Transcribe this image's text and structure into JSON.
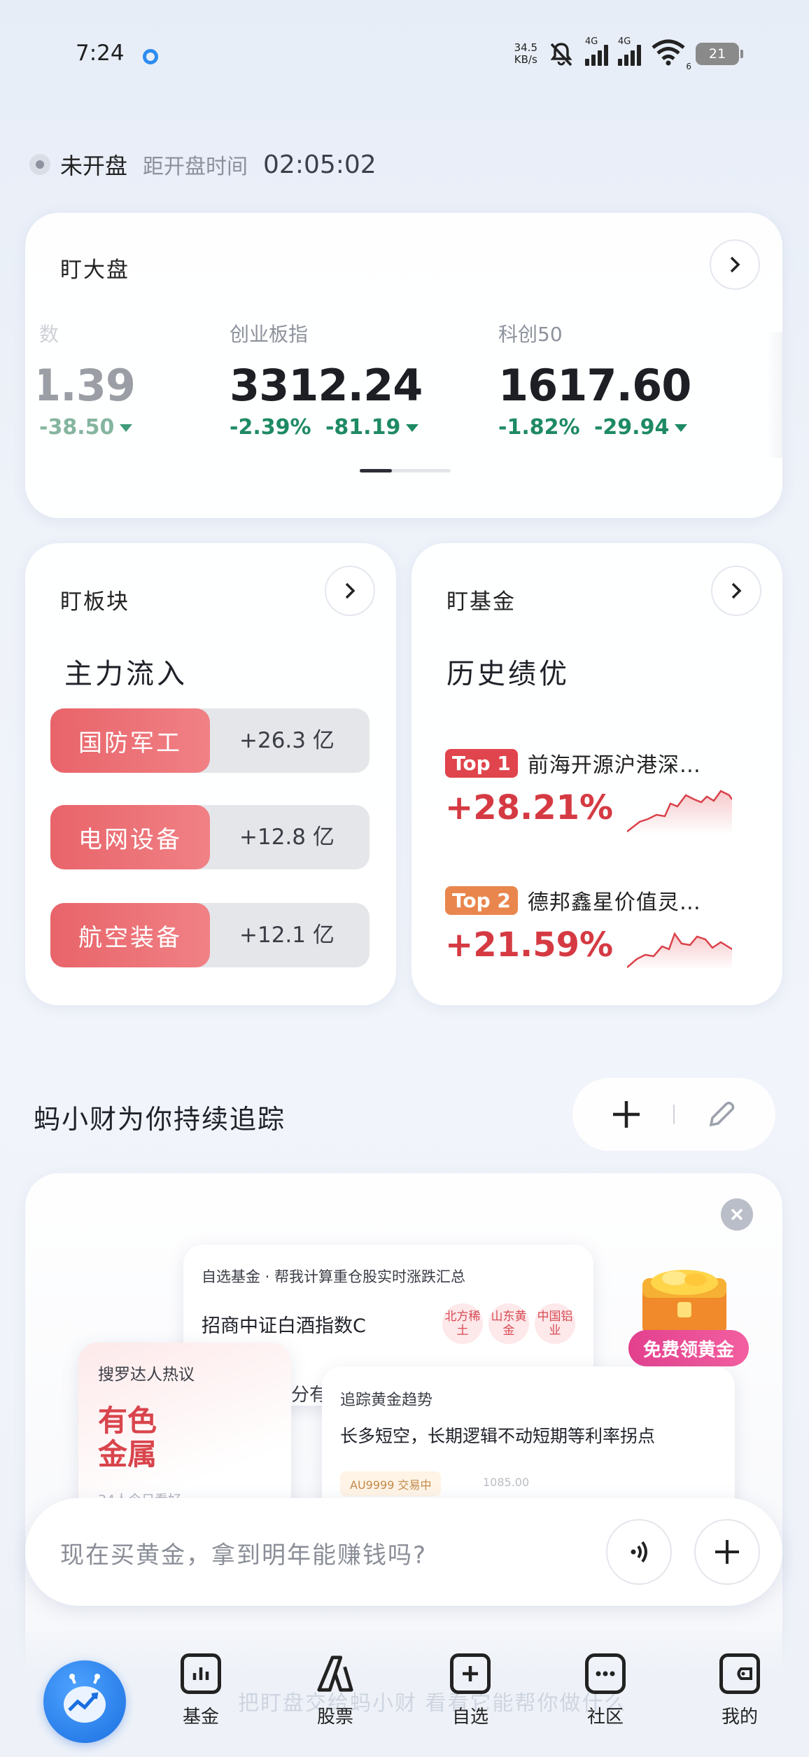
{
  "status_bar": {
    "time": "7:24",
    "net_speed_value": "34.5",
    "net_speed_unit": "KB/s",
    "signal_label_1": "4G",
    "signal_label_2": "4G",
    "wifi_label": "6",
    "battery": "21"
  },
  "market": {
    "status": "未开盘",
    "countdown_label": "距开盘时间",
    "countdown": "02:05:02"
  },
  "watch_market": {
    "title": "盯大盘",
    "indices": [
      {
        "name": "数",
        "value": "1.39",
        "change_pct": "",
        "change": "-38.50"
      },
      {
        "name": "创业板指",
        "value": "3312.24",
        "change_pct": "-2.39%",
        "change": "-81.19"
      },
      {
        "name": "科创50",
        "value": "1617.60",
        "change_pct": "-1.82%",
        "change": "-29.94"
      }
    ]
  },
  "watch_sector": {
    "title": "盯板块",
    "subtitle": "主力流入",
    "items": [
      {
        "name": "国防军工",
        "value": "+26.3 亿"
      },
      {
        "name": "电网设备",
        "value": "+12.8 亿"
      },
      {
        "name": "航空装备",
        "value": "+12.1 亿"
      }
    ]
  },
  "watch_fund": {
    "title": "盯基金",
    "subtitle": "历史绩优",
    "items": [
      {
        "badge": "Top 1",
        "name": "前海开源沪港深…",
        "return": "+28.21%",
        "badge_color": "#e0444c"
      },
      {
        "badge": "Top 2",
        "name": "德邦鑫星价值灵…",
        "return": "+21.59%",
        "badge_color": "#e9864d"
      }
    ]
  },
  "tracking": {
    "title": "蚂小财为你持续追踪",
    "fund_card": {
      "header": "自选基金 · 帮我计算重仓股实时涨跌汇总",
      "fund_name": "招商中证白酒指数C",
      "tags": [
        "北方稀土",
        "山东黄金",
        "中国铝业"
      ]
    },
    "hot_card": {
      "header": "搜罗达人热议",
      "topic_line1": "有色",
      "topic_line2": "金属",
      "people": "34人今日看好"
    },
    "partial_text": "分有",
    "gold_card": {
      "header": "追踪黄金趋势",
      "content": "长多短空，长期逻辑不动短期等利率拐点",
      "tag": "AU9999 交易中",
      "price": "1085.00"
    },
    "promo": "免费领黄金"
  },
  "input": {
    "placeholder": "现在买黄金，拿到明年能赚钱吗?"
  },
  "tabbar": {
    "background_text": "把盯盘交给蚂小财 看看它能帮你做什么",
    "tabs": [
      {
        "label": "基金"
      },
      {
        "label": "股票"
      },
      {
        "label": "自选"
      },
      {
        "label": "社区"
      },
      {
        "label": "我的"
      }
    ]
  },
  "colors": {
    "up_red": "#d53a42",
    "down_green": "#1e8a63",
    "accent_blue": "#2d8cf0"
  }
}
